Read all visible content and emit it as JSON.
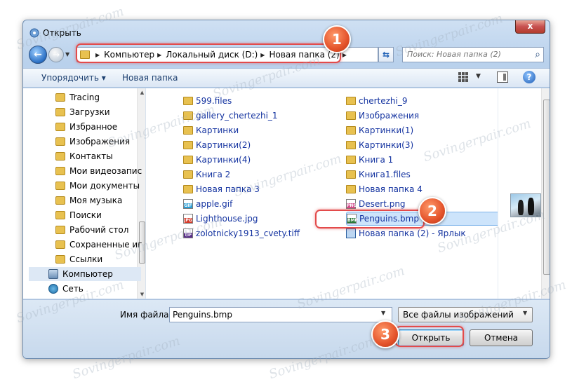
{
  "window": {
    "title": "Открыть",
    "close_label": "x"
  },
  "nav": {
    "back_icon": "back-arrow-icon",
    "forward_icon": "forward-arrow-icon"
  },
  "address": {
    "crumbs": [
      "Компьютер",
      "Локальный диск (D:)",
      "Новая папка (2)"
    ]
  },
  "search": {
    "placeholder": "Поиск: Новая папка (2)"
  },
  "toolbar": {
    "organize_label": "Упорядочить ▾",
    "new_folder_label": "Новая папка",
    "help_label": "?"
  },
  "sidebar": {
    "items": [
      {
        "label": "Tracing",
        "icon": "folder"
      },
      {
        "label": "Загрузки",
        "icon": "folder"
      },
      {
        "label": "Избранное",
        "icon": "folder"
      },
      {
        "label": "Изображения",
        "icon": "folder"
      },
      {
        "label": "Контакты",
        "icon": "folder"
      },
      {
        "label": "Мои видеозапис",
        "icon": "folder"
      },
      {
        "label": "Мои документы",
        "icon": "folder"
      },
      {
        "label": "Моя музыка",
        "icon": "folder"
      },
      {
        "label": "Поиски",
        "icon": "folder"
      },
      {
        "label": "Рабочий стол",
        "icon": "folder"
      },
      {
        "label": "Сохраненные иг",
        "icon": "folder"
      },
      {
        "label": "Ссылки",
        "icon": "folder"
      },
      {
        "label": "Компьютер",
        "icon": "computer"
      },
      {
        "label": "Сеть",
        "icon": "network"
      }
    ]
  },
  "files": {
    "col1": [
      {
        "name": "599.files",
        "type": "folder"
      },
      {
        "name": "gallery_chertezhi_1",
        "type": "folder"
      },
      {
        "name": "Картинки",
        "type": "folder"
      },
      {
        "name": "Картинки(2)",
        "type": "folder"
      },
      {
        "name": "Картинки(4)",
        "type": "folder"
      },
      {
        "name": "Книга 2",
        "type": "folder"
      },
      {
        "name": "Новая папка 3",
        "type": "folder"
      },
      {
        "name": "apple.gif",
        "type": "gif"
      },
      {
        "name": "Lighthouse.jpg",
        "type": "jpg"
      },
      {
        "name": "zolotnicky1913_cvety.tiff",
        "type": "tif"
      }
    ],
    "col2": [
      {
        "name": "chertezhi_9",
        "type": "folder"
      },
      {
        "name": "Изображения",
        "type": "folder"
      },
      {
        "name": "Картинки(1)",
        "type": "folder"
      },
      {
        "name": "Картинки(3)",
        "type": "folder"
      },
      {
        "name": "Книга 1",
        "type": "folder"
      },
      {
        "name": "Книга1.files",
        "type": "folder"
      },
      {
        "name": "Новая папка 4",
        "type": "folder"
      },
      {
        "name": "Desert.png",
        "type": "png"
      },
      {
        "name": "Penguins.bmp",
        "type": "bmp"
      },
      {
        "name": "Новая папка (2) - Ярлык",
        "type": "shortcut"
      }
    ],
    "badges": {
      "gif": "GIF",
      "jpg": "JPG",
      "tif": "TIF",
      "png": "PNG",
      "bmp": "BMP"
    }
  },
  "bottom": {
    "filename_label": "Имя файла:",
    "filename_value": "Penguins.bmp",
    "filter_value": "Все файлы изображений",
    "open_label": "Открыть",
    "cancel_label": "Отмена"
  },
  "callouts": [
    "1",
    "2",
    "3"
  ],
  "watermark": "Sovingerpair.com",
  "colors": {
    "callout": "#e4532b",
    "selection": "#cde4fb",
    "link": "#1433a0"
  }
}
